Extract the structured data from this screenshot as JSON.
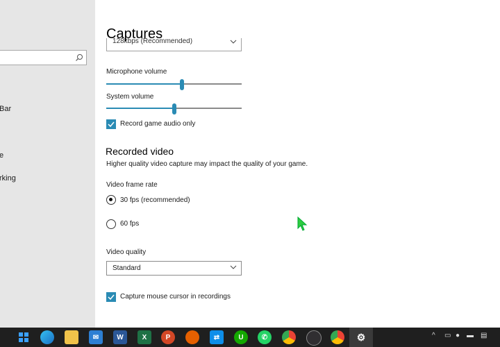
{
  "sidebar": {
    "items": [
      {
        "label": "Bar"
      },
      {
        "label": "e"
      },
      {
        "label": "rking"
      }
    ]
  },
  "main": {
    "title": "Captures",
    "audio_quality": {
      "value": "128kbps (Recommended)"
    },
    "microphone_volume": {
      "label": "Microphone volume",
      "level_percent": 56
    },
    "system_volume": {
      "label": "System volume",
      "level_percent": 50
    },
    "record_game_audio": {
      "label": "Record game audio only",
      "checked": true
    },
    "recorded_video": {
      "heading": "Recorded video",
      "description": "Higher quality video capture may impact the quality of your game."
    },
    "frame_rate": {
      "label": "Video frame rate",
      "options": [
        {
          "label": "30 fps (recommended)",
          "selected": true
        },
        {
          "label": "60 fps",
          "selected": false
        }
      ]
    },
    "video_quality": {
      "label": "Video quality",
      "value": "Standard"
    },
    "capture_cursor": {
      "label": "Capture mouse cursor in recordings",
      "checked": true
    }
  },
  "taskbar": {
    "apps": [
      "start",
      "edge",
      "file-explorer",
      "mail",
      "word",
      "excel",
      "powerpoint",
      "firefox",
      "teamviewer",
      "upwork",
      "whatsapp",
      "chrome",
      "obs",
      "chrome-profile",
      "settings"
    ],
    "tray": [
      "chevron-up",
      "network",
      "microphone",
      "battery",
      "keyboard"
    ]
  },
  "colors": {
    "accent": "#2a8bb4",
    "sidebar_bg": "#e6e6e6",
    "taskbar_bg": "#1f1f1f"
  }
}
